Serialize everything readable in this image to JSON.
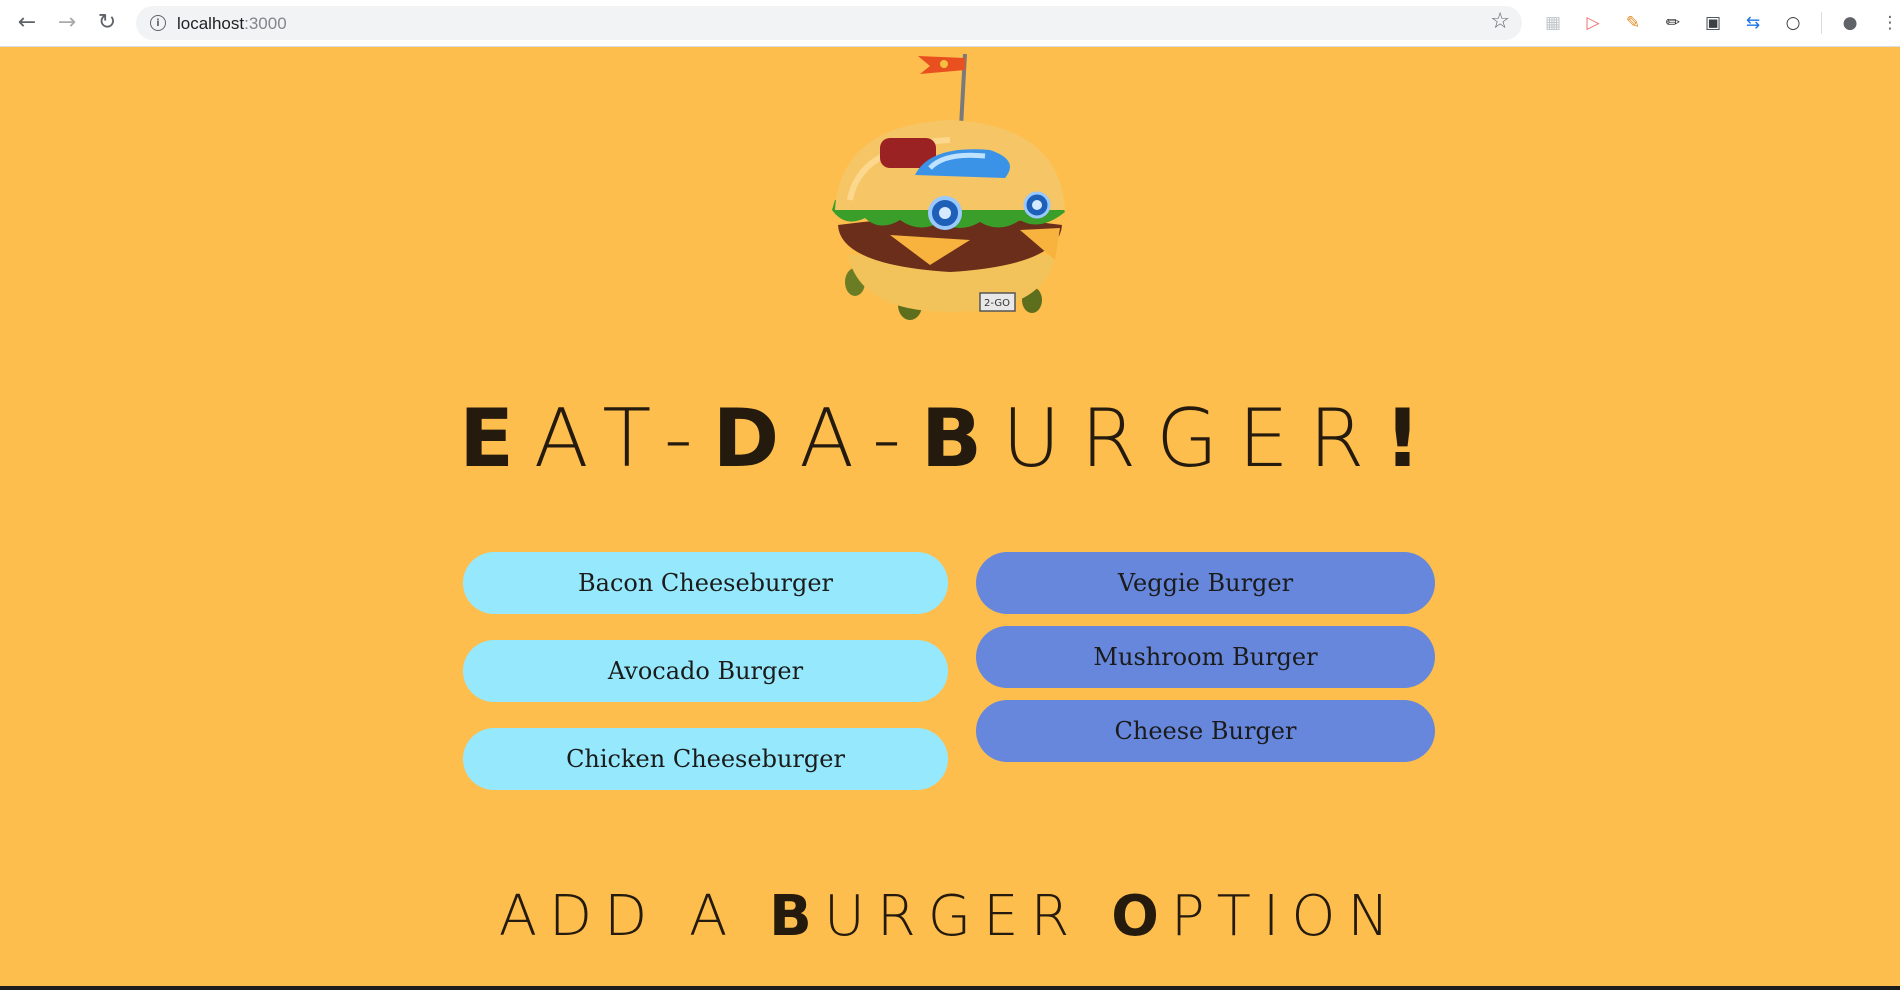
{
  "browser": {
    "url_host": "localhost",
    "url_port": ":3000"
  },
  "page": {
    "title_parts": [
      {
        "bold": "E",
        "rest": "AT-"
      },
      {
        "bold": "D",
        "rest": "A-"
      },
      {
        "bold": "B",
        "rest": "URGER"
      },
      {
        "bold": "!",
        "rest": ""
      }
    ],
    "eaten_burgers": [
      "Bacon Cheeseburger",
      "Avocado Burger",
      "Chicken Cheeseburger"
    ],
    "available_burgers": [
      "Veggie Burger",
      "Mushroom Burger",
      "Cheese Burger"
    ],
    "add_title_parts": [
      {
        "bold": "",
        "rest": "ADD A "
      },
      {
        "bold": "B",
        "rest": "URGER "
      },
      {
        "bold": "O",
        "rest": "PTION"
      }
    ]
  },
  "colors": {
    "background": "#fdbe4d",
    "left_button": "#96e9fd",
    "right_button": "#6687dc"
  }
}
